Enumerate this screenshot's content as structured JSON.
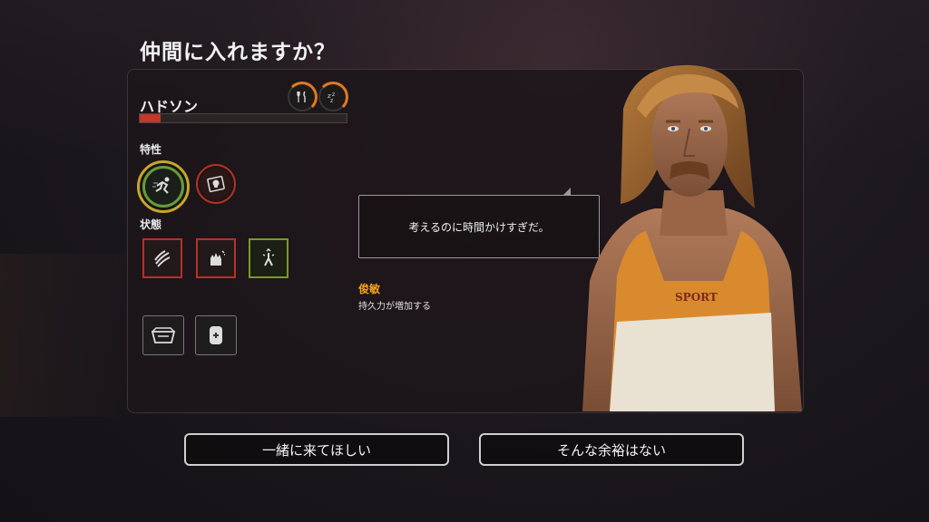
{
  "dialog": {
    "title": "仲間に入れますか？"
  },
  "character": {
    "name": "ハドソン",
    "health_fraction": 0.1,
    "needs": [
      {
        "icon": "fork-knife-icon",
        "fill_fraction": 0.25
      },
      {
        "icon": "sleep-zz-icon",
        "fill_fraction": 0.25
      }
    ],
    "traits_label": "特性",
    "status_label": "状態",
    "speech": "考えるのに時間かけすぎだ。",
    "selected_trait": {
      "title": "俊敏",
      "description": "持久力が増加する"
    },
    "shirt_text": "SPORT"
  },
  "buttons": {
    "accept": "一緒に来てほしい",
    "decline": "そんな余裕はない"
  },
  "colors": {
    "accent_orange": "#e07a1f",
    "trait_title": "#f0a020",
    "status_red": "#b8302a",
    "status_green": "#7a9a2a",
    "trait_gold": "#caa42a"
  }
}
